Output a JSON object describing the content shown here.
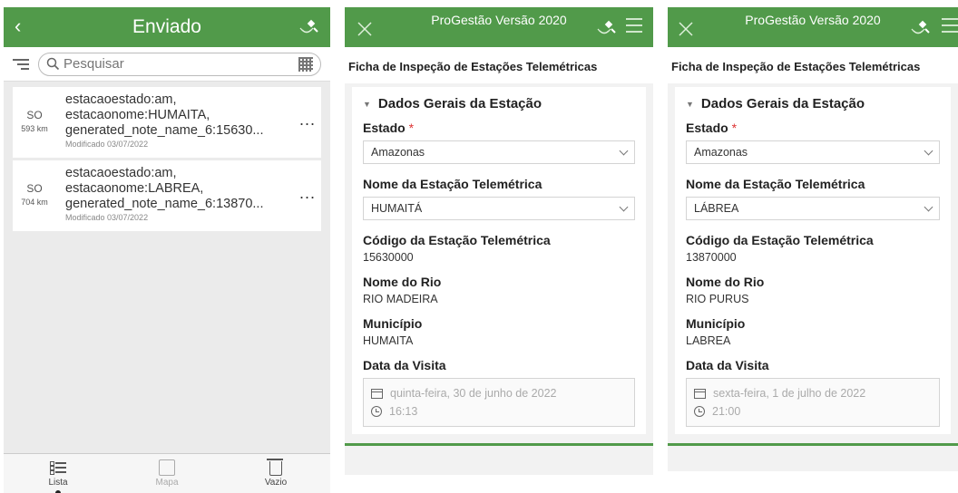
{
  "colors": {
    "header_green": "#519a4a"
  },
  "panel1": {
    "back_icon": "chevron-left-icon",
    "title": "Enviado",
    "gps_icon": "satellite-gps-icon",
    "search_placeholder": "Pesquisar",
    "items": [
      {
        "direction": "SO",
        "distance": "593 km",
        "line1": "estacaoestado:am,",
        "line2": "estacaonome:HUMAITA,",
        "line3": "generated_note_name_6:15630...",
        "modified": "Modificado 03/07/2022",
        "more": "..."
      },
      {
        "direction": "SO",
        "distance": "704 km",
        "line1": "estacaoestado:am,",
        "line2": "estacaonome:LABREA,",
        "line3": "generated_note_name_6:13870...",
        "modified": "Modificado 03/07/2022",
        "more": "..."
      }
    ],
    "tabs": {
      "list": "Lista",
      "map": "Mapa",
      "empty": "Vazio"
    }
  },
  "panel2": {
    "title": "ProGestão Versão 2020",
    "form_title": "Ficha de Inspeção de Estações Telemétricas",
    "section": "Dados Gerais da Estação",
    "estado_label": "Estado",
    "required_mark": "*",
    "estado_value": "Amazonas",
    "nome_estacao_label": "Nome da Estação Telemétrica",
    "nome_estacao_value": "HUMAITÁ",
    "codigo_label": "Código da Estação Telemétrica",
    "codigo_value": "15630000",
    "rio_label": "Nome do Rio",
    "rio_value": "RIO MADEIRA",
    "municipio_label": "Município",
    "municipio_value": "HUMAITA",
    "data_label": "Data da Visita",
    "date_value": "quinta-feira, 30 de junho de 2022",
    "time_value": "16:13"
  },
  "panel3": {
    "title": "ProGestão Versão 2020",
    "form_title": "Ficha de Inspeção de Estações Telemétricas",
    "section": "Dados Gerais da Estação",
    "estado_label": "Estado",
    "required_mark": "*",
    "estado_value": "Amazonas",
    "nome_estacao_label": "Nome da Estação Telemétrica",
    "nome_estacao_value": "LÁBREA",
    "codigo_label": "Código da Estação Telemétrica",
    "codigo_value": "13870000",
    "rio_label": "Nome do Rio",
    "rio_value": "RIO PURUS",
    "municipio_label": "Município",
    "municipio_value": "LABREA",
    "data_label": "Data da Visita",
    "date_value": "sexta-feira, 1 de julho de 2022",
    "time_value": "21:00"
  }
}
